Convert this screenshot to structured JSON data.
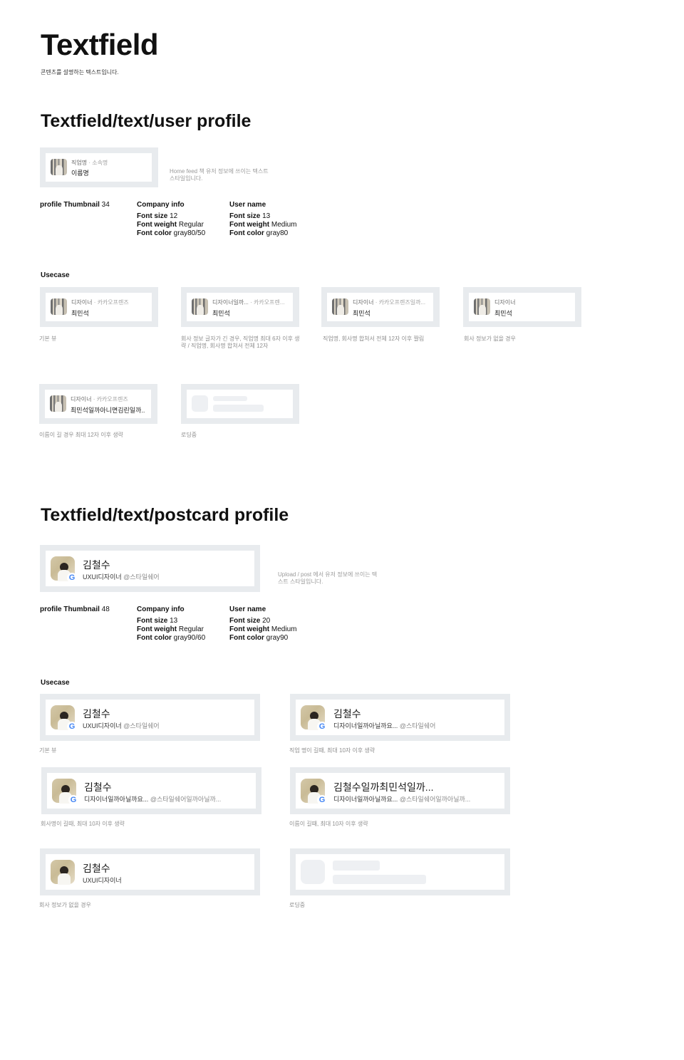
{
  "header": {
    "title": "Textfield",
    "description": "콘텐츠를 설명하는 텍스트입니다."
  },
  "user_profile": {
    "title": "Textfield/text/user profile",
    "example": {
      "company": "직업명",
      "org": "소속명",
      "name": "이름명"
    },
    "note": "Home feed 책 유저 정보에 쓰이는 텍스트 스타일입니다.",
    "specs": {
      "thumb_label": "profile Thumbnail",
      "thumb_value": "34",
      "company_title": "Company info",
      "company_size_label": "Font size",
      "company_size": "12",
      "company_weight_label": "Font weight",
      "company_weight": "Regular",
      "company_color_label": "Font color",
      "company_color": "gray80/50",
      "user_title": "User name",
      "user_size_label": "Font size",
      "user_size": "13",
      "user_weight_label": "Font weight",
      "user_weight": "Medium",
      "user_color_label": "Font color",
      "user_color": "gray80"
    },
    "usecase_title": "Usecase",
    "usecases": [
      {
        "company": "디자이너",
        "org": "· 카카오프렌즈",
        "name": "최민석",
        "caption": "기본 뷰"
      },
      {
        "company": "디자이너일까...",
        "org": "· 카카오프렌...",
        "name": "최민석",
        "caption": "회사 정보 글자가 긴 경우, 직업명 최대 6자 이후 생략 / 직업명, 회사명 합쳐서 전체 12자"
      },
      {
        "company": "디자이너",
        "org": "· 카카오프렌즈일까...",
        "name": "최민석",
        "caption": "직업명, 회사명 합쳐서 전체 12자 이후 짤림"
      },
      {
        "company": "디자이너",
        "org": "",
        "name": "최민석",
        "caption": "회사 정보가 없을 경우"
      },
      {
        "company": "디자이너",
        "org": "· 카카오프렌즈",
        "name": "최민석일까아니면김린일까..",
        "caption": "이름이 길 경우 최대 12자 이후 생략"
      },
      {
        "caption": "로딩중"
      }
    ]
  },
  "postcard_profile": {
    "title": "Textfield/text/postcard profile",
    "example": {
      "name": "김철수",
      "company": "UXUI디자이너",
      "handle": "@스타일쉐어"
    },
    "note": "Upload / post 에서 유저 정보에 쓰이는 텍스트 스타일입니다.",
    "specs": {
      "thumb_label": "profile Thumbnail",
      "thumb_value": "48",
      "company_title": "Company info",
      "company_size_label": "Font size",
      "company_size": "13",
      "company_weight_label": "Font weight",
      "company_weight": "Regular",
      "company_color_label": "Font color",
      "company_color": "gray90/60",
      "user_title": "User name",
      "user_size_label": "Font size",
      "user_size": "20",
      "user_weight_label": "Font weight",
      "user_weight": "Medium",
      "user_color_label": "Font color",
      "user_color": "gray90"
    },
    "usecase_title": "Usecase",
    "usecases": [
      {
        "name": "김철수",
        "company": "UXUI디자이너",
        "handle": "@스타일쉐어",
        "caption": "기본 뷰"
      },
      {
        "name": "김철수",
        "company": "디자이너일까아닐까요...",
        "handle": "@스타일쉐어",
        "caption": "직업 명이 길때, 최대 10자 이후 생략"
      },
      {
        "name": "김철수",
        "company": "디자이너일까아닐까요...",
        "handle": "@스타일쉐어일까아닐까...",
        "caption": "회사명이 길때, 최대 10자 이후 생략"
      },
      {
        "name": "김철수일까최민석일까...",
        "company": "디자이너일까아닐까요...",
        "handle": "@스타일쉐어일까아닐까...",
        "caption": "이름이 길때, 최대 10자 이후 생략"
      },
      {
        "name": "김철수",
        "company": "UXUI디자이너",
        "handle": "",
        "caption": "회사 정보가 없을 경우"
      },
      {
        "caption": "로딩중"
      }
    ],
    "google_glyph": "G"
  },
  "colors": {
    "frame": "#e8ebee",
    "skeleton": "#eef0f3",
    "google_blue": "#4285f4"
  }
}
